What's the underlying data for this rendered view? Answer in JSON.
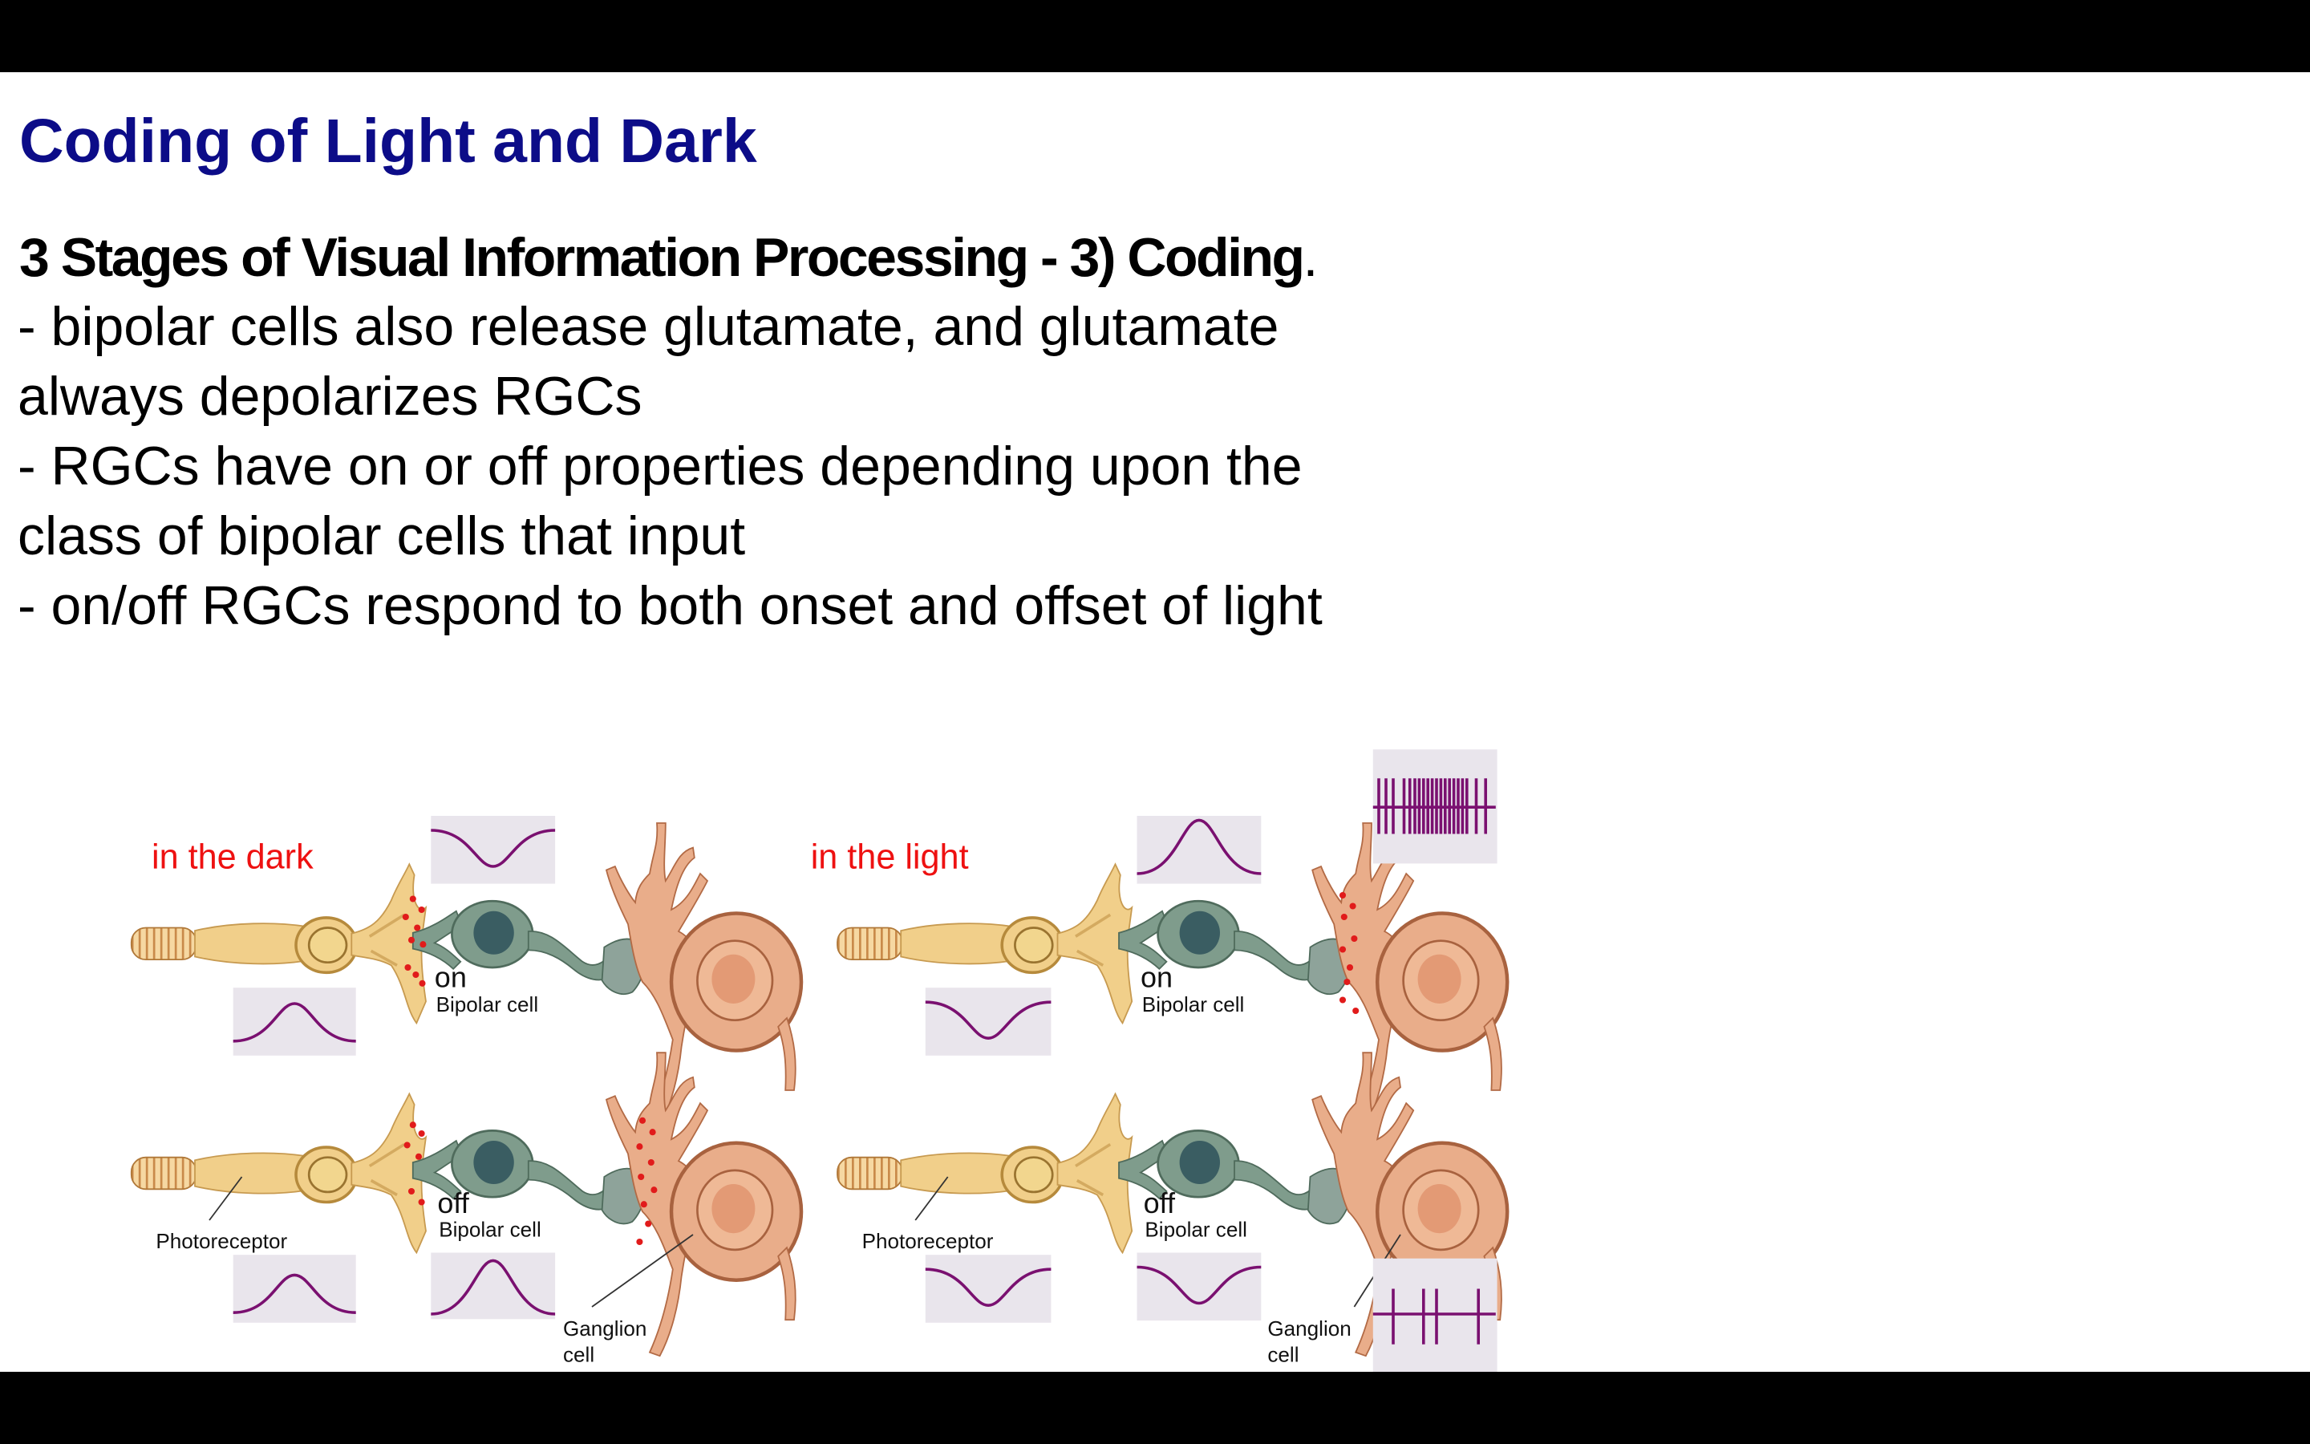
{
  "slide": {
    "title": "Coding of Light and Dark",
    "subtitle": "3 Stages of Visual Information Processing - 3) Coding",
    "subtitle_end": ".",
    "bullets": [
      "- bipolar cells also release glutamate, and glutamate",
      "   always depolarizes RGCs",
      "- RGCs have on or off properties depending upon the",
      "   class of bipolar cells that input",
      "- on/off RGCs respond to both onset and offset of light"
    ]
  },
  "figure": {
    "dark_label": "in the dark",
    "light_label": "in the light",
    "on_tag": "on",
    "off_tag": "off",
    "bipolar_label": "Bipolar cell",
    "photoreceptor_label": "Photoreceptor",
    "ganglion_label_1": "Ganglion",
    "ganglion_label_2": "cell"
  },
  "colors": {
    "title": "#0c0c88",
    "red_label": "#ee1111",
    "waveform": "#7a1070",
    "photoreceptor": "#f1cf8a",
    "bipolar": "#7f9c8c",
    "ganglion": "#e9ad8a",
    "glutamate": "#e11b1b"
  }
}
